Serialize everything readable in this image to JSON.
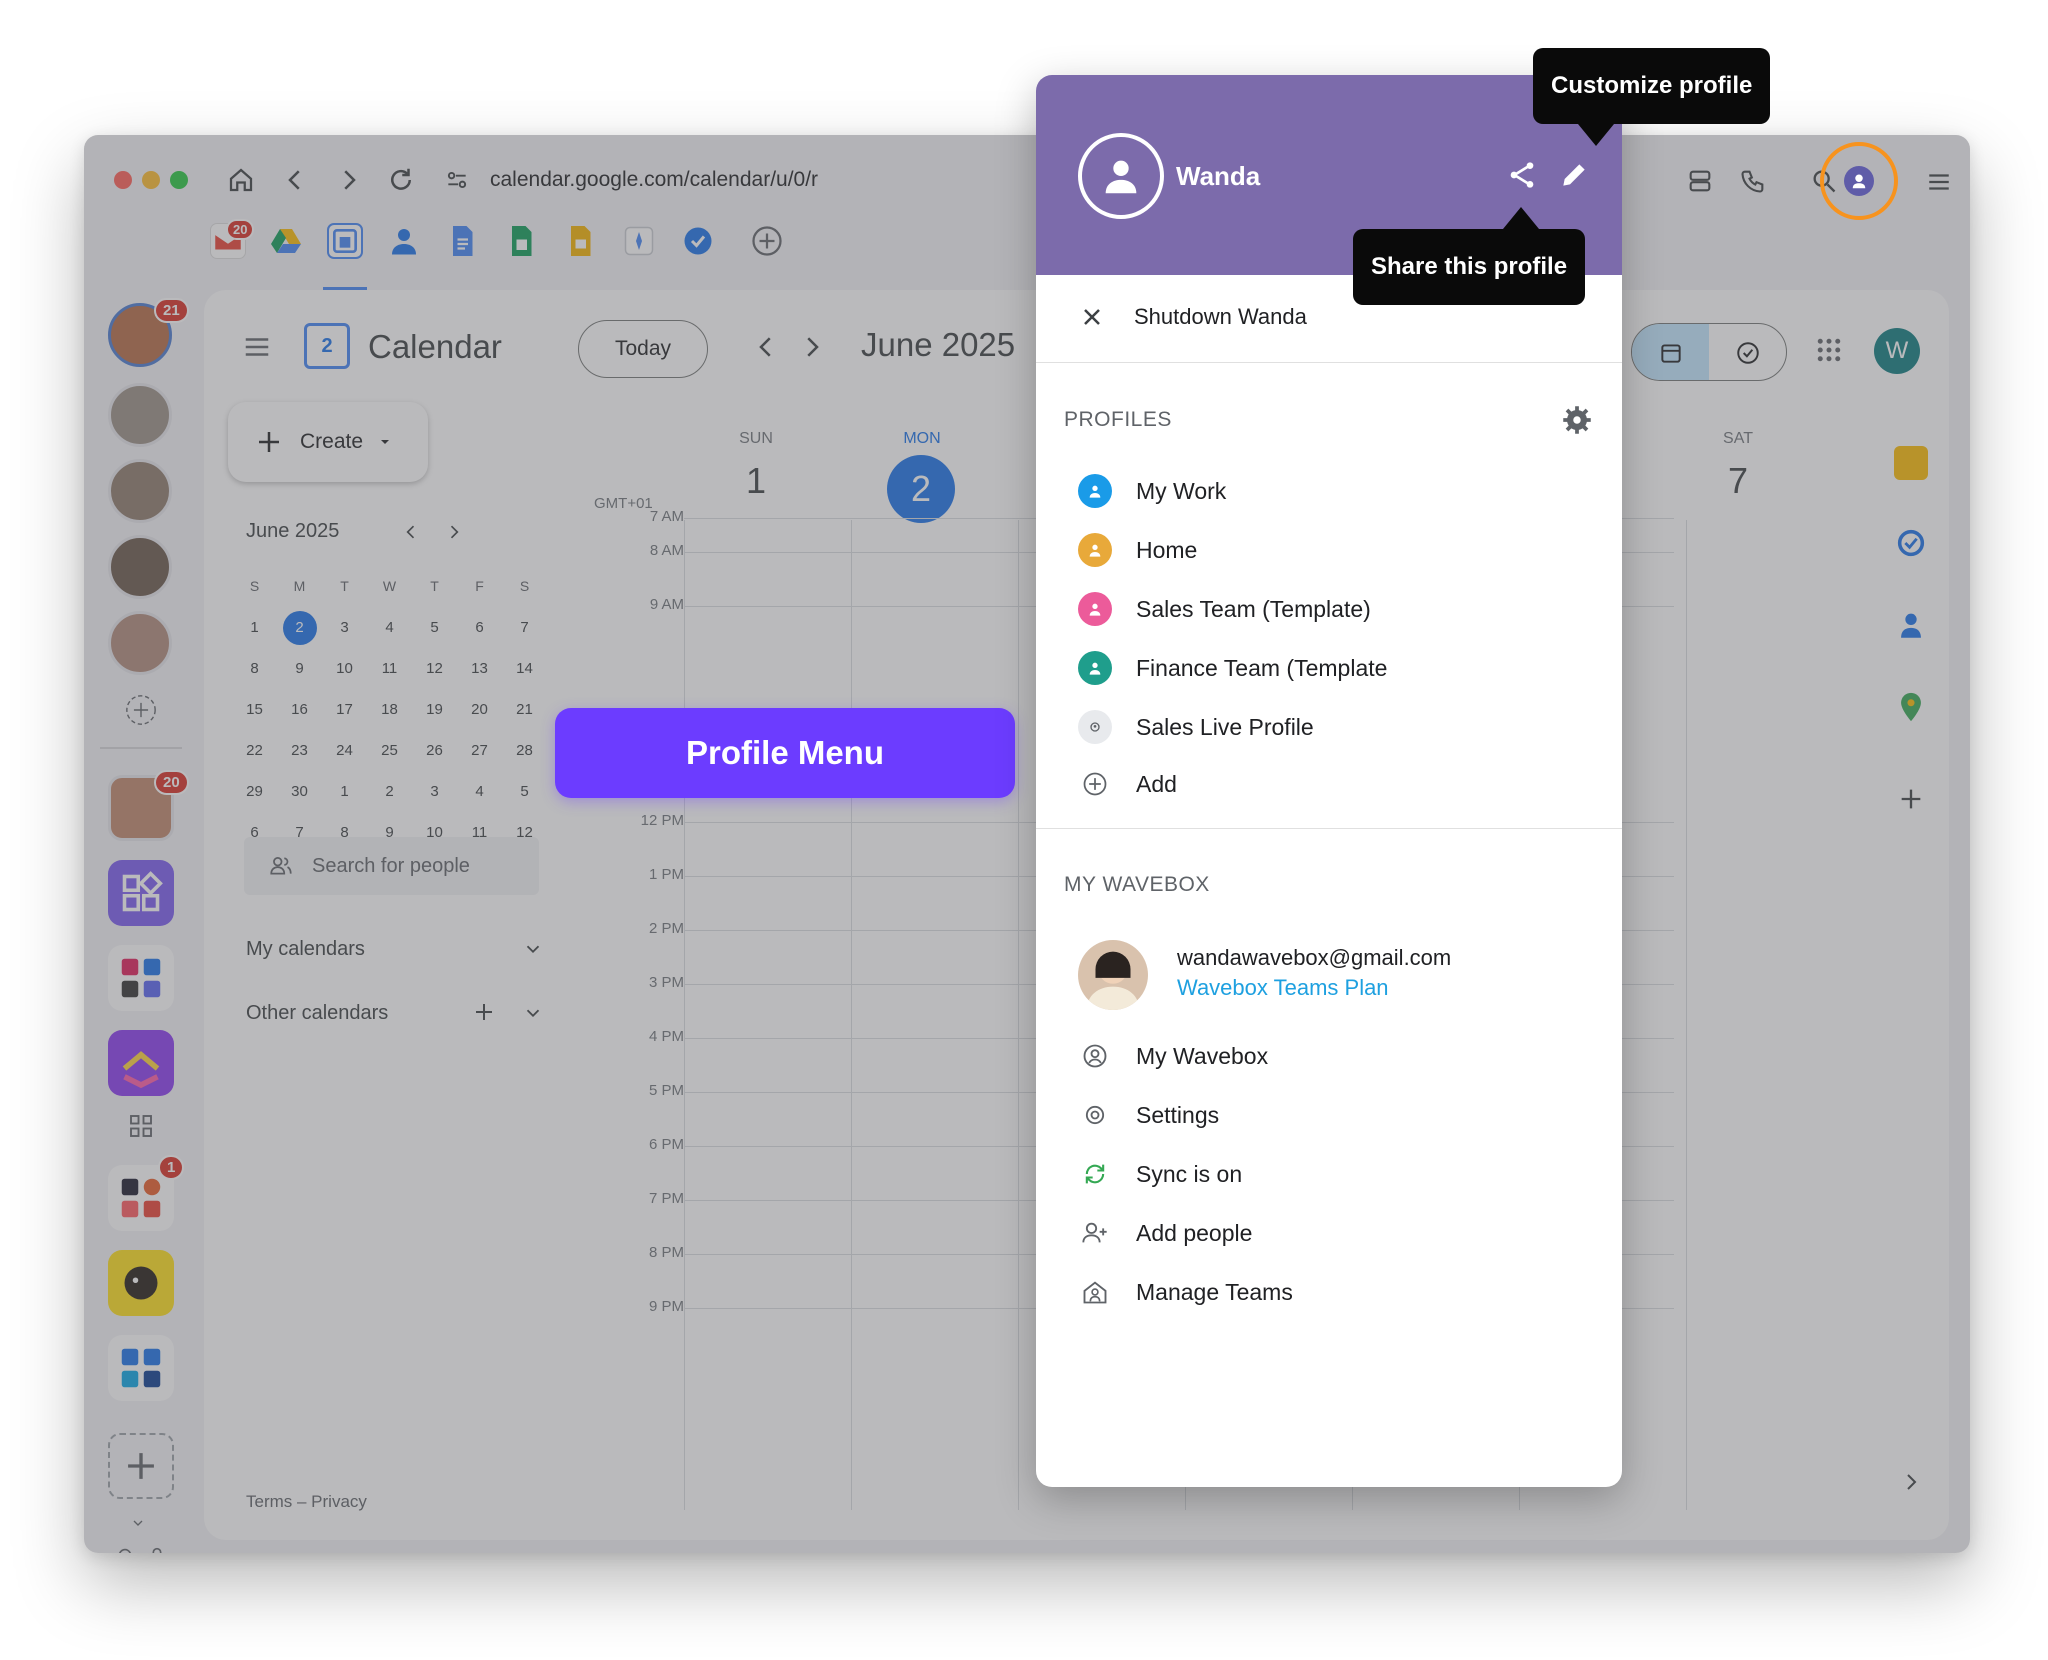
{
  "browser": {
    "url": "calendar.google.com/calendar/u/0/r"
  },
  "app_rail": {
    "badges": [
      "21",
      "20",
      "20",
      "1"
    ]
  },
  "calendar": {
    "title": "Calendar",
    "logo_day": "2",
    "today_button": "Today",
    "month_label": "June 2025",
    "create_label": "Create",
    "mini_title": "June 2025",
    "weekday_initials": [
      "S",
      "M",
      "T",
      "W",
      "T",
      "F",
      "S"
    ],
    "mini_weeks": [
      [
        "1",
        "2",
        "3",
        "4",
        "5",
        "6",
        "7"
      ],
      [
        "8",
        "9",
        "10",
        "11",
        "12",
        "13",
        "14"
      ],
      [
        "15",
        "16",
        "17",
        "18",
        "19",
        "20",
        "21"
      ],
      [
        "22",
        "23",
        "24",
        "25",
        "26",
        "27",
        "28"
      ],
      [
        "29",
        "30",
        "1",
        "2",
        "3",
        "4",
        "5"
      ],
      [
        "6",
        "7",
        "8",
        "9",
        "10",
        "11",
        "12"
      ]
    ],
    "search_people": "Search for people",
    "my_calendars": "My calendars",
    "other_calendars": "Other calendars",
    "footer": "Terms – Privacy",
    "timezone": "GMT+01",
    "days": [
      {
        "name": "SUN",
        "num": "1"
      },
      {
        "name": "MON",
        "num": "2"
      },
      {
        "name": "SAT",
        "num": "7"
      }
    ],
    "hours": [
      "7 AM",
      "8 AM",
      "9 AM",
      "12 PM",
      "1 PM",
      "2 PM",
      "3 PM",
      "4 PM",
      "5 PM",
      "6 PM",
      "7 PM",
      "8 PM",
      "9 PM"
    ],
    "account_initial": "W"
  },
  "callout": {
    "profile_menu": "Profile Menu"
  },
  "tooltips": {
    "customize": "Customize profile",
    "share": "Share this profile"
  },
  "profile_panel": {
    "name": "Wanda",
    "shutdown": "Shutdown Wanda",
    "profiles_header": "PROFILES",
    "profiles": [
      {
        "label": "My Work",
        "color": "#1a9be8"
      },
      {
        "label": "Home",
        "color": "#e8a93a"
      },
      {
        "label": "Sales Team (Template)",
        "color": "#ec5b9a"
      },
      {
        "label": "Finance Team (Template",
        "color": "#1f9e8c"
      },
      {
        "label": "Sales Live Profile",
        "color": "#dadce0"
      }
    ],
    "add_label": "Add",
    "wavebox_header": "MY WAVEBOX",
    "email": "wandawavebox@gmail.com",
    "plan": "Wavebox Teams Plan",
    "menu": [
      "My Wavebox",
      "Settings",
      "Sync is on",
      "Add people",
      "Manage Teams"
    ],
    "accent_color": "#7c6bab",
    "highlight_color": "#f7931e"
  }
}
